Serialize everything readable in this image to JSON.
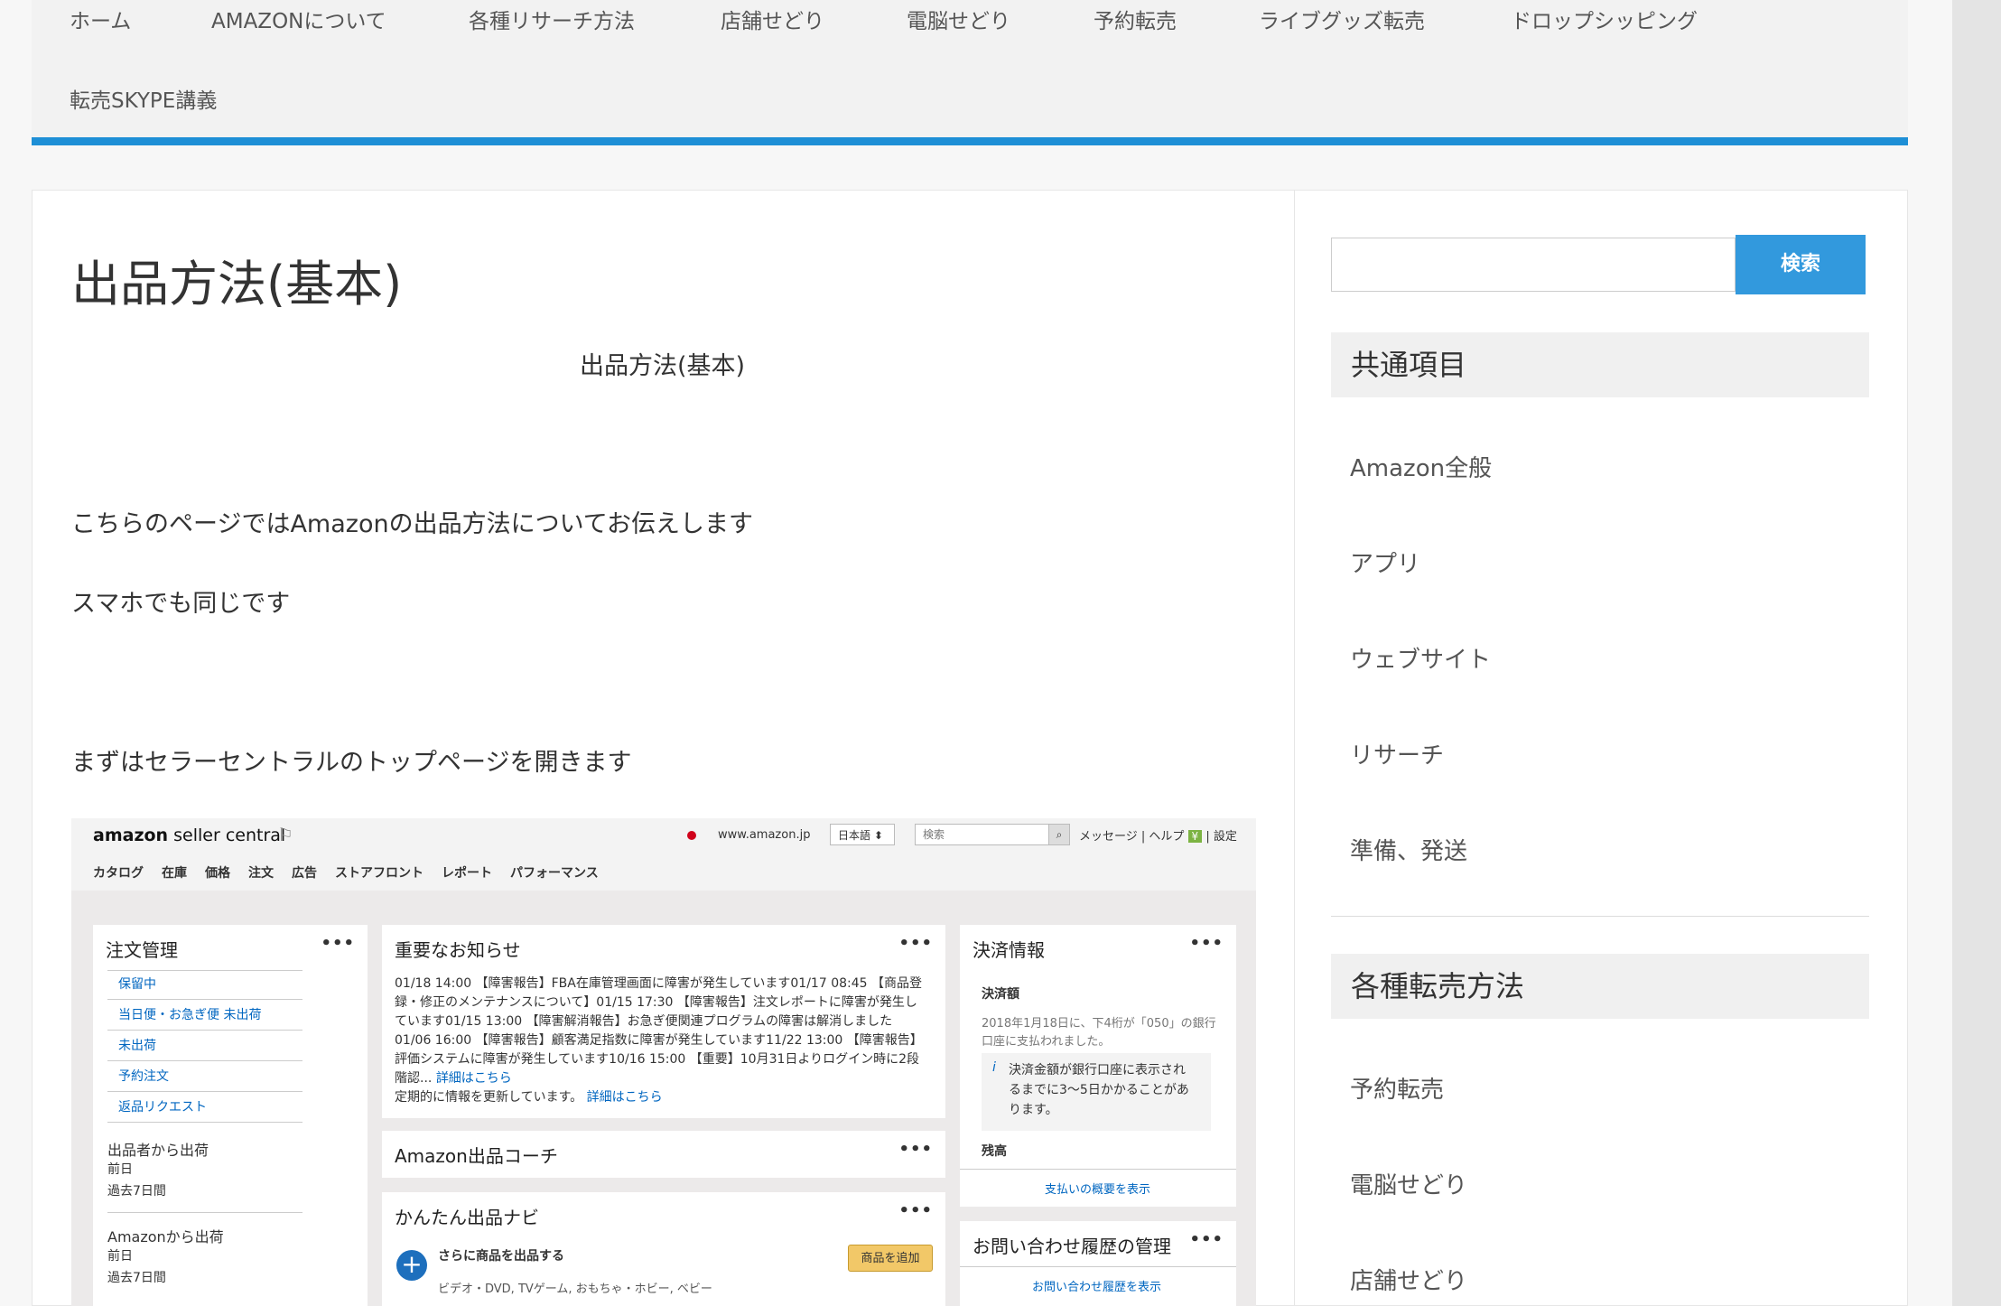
{
  "nav": {
    "items": [
      "ホーム",
      "AMAZONについて",
      "各種リサーチ方法",
      "店舗せどり",
      "電脳せどり",
      "予約転売",
      "ライブグッズ転売",
      "ドロップシッピング",
      "転売SKYPE講義"
    ]
  },
  "article": {
    "title": "出品方法(基本)",
    "subtitle": "出品方法(基本)",
    "para1": "こちらのページではAmazonの出品方法についてお伝えします",
    "para2": "スマホでも同じです",
    "para3": "まずはセラーセントラルのトップページを開きます"
  },
  "screenshot": {
    "logo_bold": "amazon",
    "logo_rest": " seller central",
    "site": "www.amazon.jp",
    "lang": "日本語 ⬍",
    "search_placeholder": "検索",
    "links": "メッセージ | ヘルプ",
    "yen": "¥",
    "settings": "| 設定",
    "menu": [
      "カタログ",
      "在庫",
      "価格",
      "注文",
      "広告",
      "ストアフロント",
      "レポート",
      "パフォーマンス"
    ],
    "order_card": {
      "title": "注文管理",
      "items": [
        "保留中",
        "当日便・お急ぎ便 未出荷",
        "未出荷",
        "予約注文",
        "返品リクエスト"
      ],
      "seller_ship": "出品者から出荷",
      "seller_prev": "前日",
      "seller_7d": "過去7日間",
      "amazon_ship": "Amazonから出荷",
      "amazon_prev": "前日",
      "amazon_7d": "過去7日間"
    },
    "news_card": {
      "title": "重要なお知らせ",
      "lines": [
        "01/18 14:00 【障害報告】FBA在庫管理画面に障害が発生しています01/17 08:45 【商品登",
        "録・修正のメンテナンスについて】01/15 17:30 【障害報告】注文レポートに障害が発生し",
        "ています01/15 13:00 【障害解消報告】お急ぎ便関連プログラムの障害は解消しました",
        "01/06 16:00 【障害報告】顧客満足指数に障害が発生しています11/22 13:00 【障害報告】",
        "評価システムに障害が発生しています10/16 15:00 【重要】10月31日よりログイン時に2段"
      ],
      "line6": "階認...",
      "more": "詳細はこちら",
      "update": "定期的に情報を更新しています。",
      "update_more": "詳細はこちら"
    },
    "coach_card": {
      "title": "Amazon出品コーチ"
    },
    "navi_card": {
      "title": "かんたん出品ナビ",
      "item_title": "さらに商品を出品する",
      "item_desc": "ビデオ・DVD, TVゲーム, おもちゃ・ホビー, ベビー",
      "button": "商品を追加"
    },
    "payment_card": {
      "title": "決済情報",
      "label": "決済額",
      "desc1": "2018年1月18日に、下4桁が「050」の銀行",
      "desc2": "口座に支払われました。",
      "info1": "決済金額が銀行口座に表示され",
      "info2": "るまでに3〜5日かかることがあ",
      "info3": "ります。",
      "balance": "残高",
      "link": "支払いの概要を表示"
    },
    "inquiry_card": {
      "title": "お問い合わせ履歴の管理",
      "link": "お問い合わせ履歴を表示"
    }
  },
  "sidebar": {
    "search_button": "検索",
    "section1": "共通項目",
    "items1": [
      "Amazon全般",
      "アプリ",
      "ウェブサイト",
      "リサーチ",
      "準備、発送"
    ],
    "section2": "各種転売方法",
    "items2": [
      "予約転売",
      "電脳せどり",
      "店舗せどり"
    ]
  }
}
